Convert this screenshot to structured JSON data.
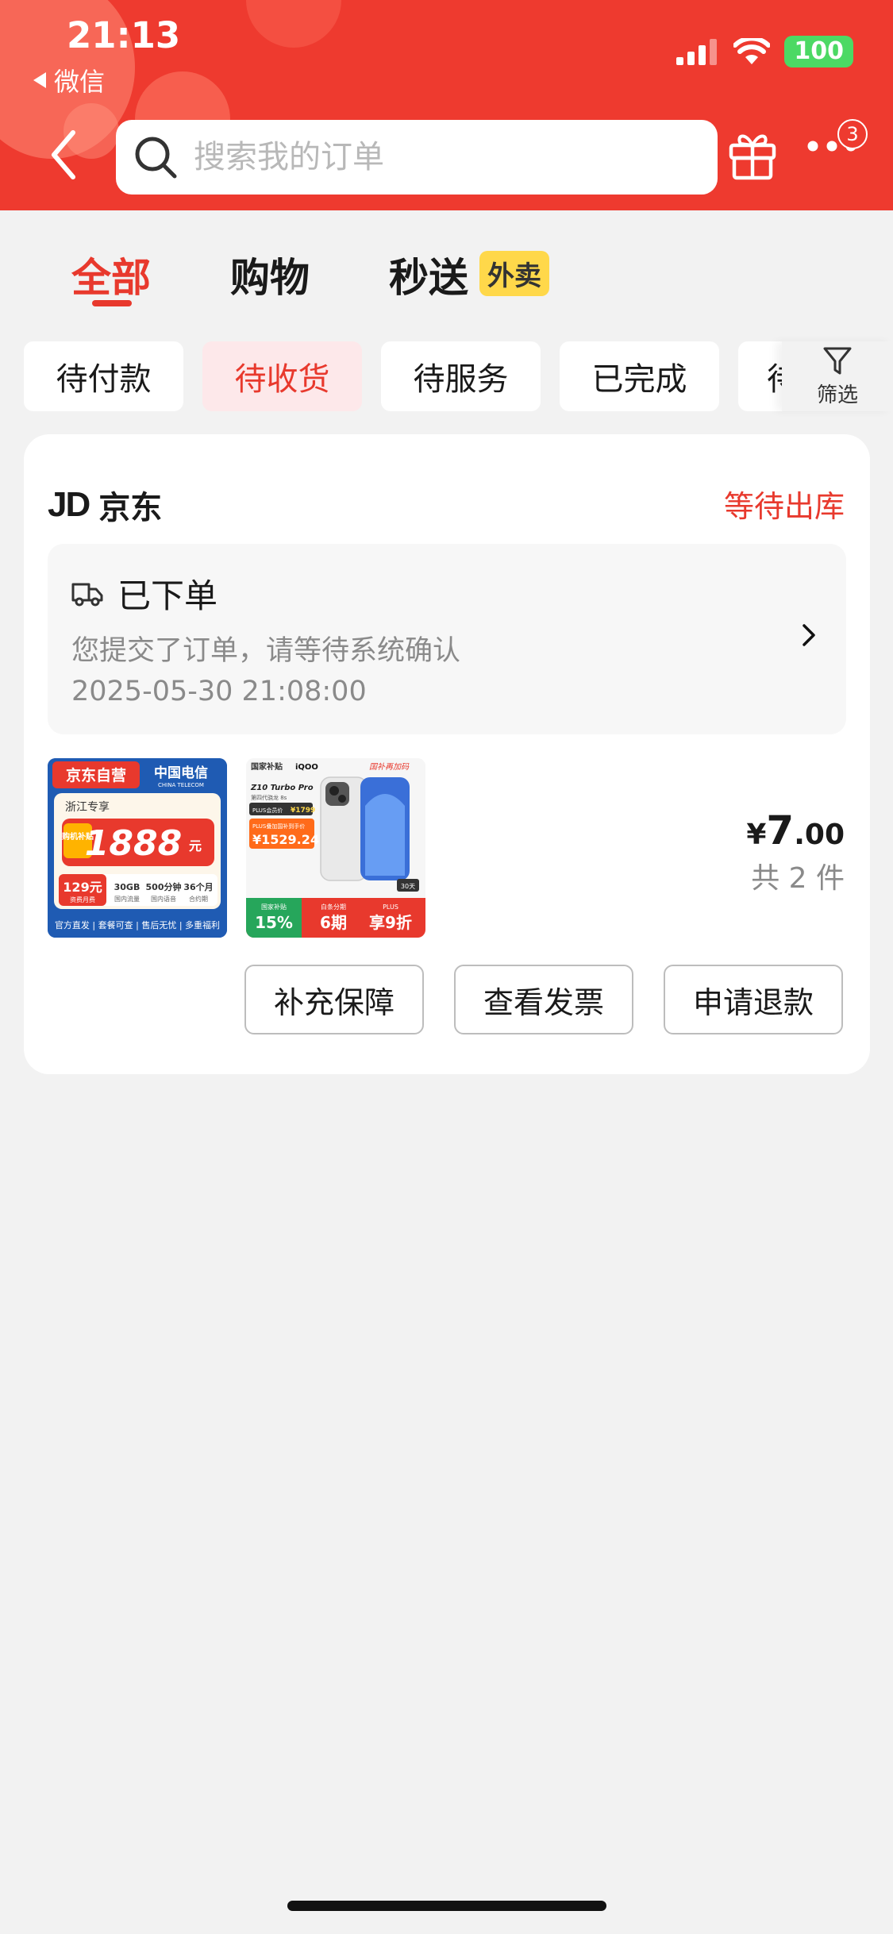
{
  "status_bar": {
    "time": "21:13",
    "back_app": "微信",
    "battery": "100"
  },
  "header": {
    "search_placeholder": "搜索我的订单",
    "more_badge": "3"
  },
  "tabs": [
    {
      "label": "全部",
      "active": true
    },
    {
      "label": "购物",
      "active": false
    },
    {
      "label": "秒送",
      "active": false,
      "tag": "外卖"
    }
  ],
  "chips": [
    {
      "label": "待付款",
      "active": false
    },
    {
      "label": "待收货",
      "active": true
    },
    {
      "label": "待服务",
      "active": false
    },
    {
      "label": "已完成",
      "active": false
    },
    {
      "label": "待",
      "active": false
    }
  ],
  "filter_label": "筛选",
  "order": {
    "shop_logo": "JD",
    "shop_name": "京东",
    "status": "等待出库",
    "track_title": "已下单",
    "track_desc": "您提交了订单，请等待系统确认",
    "track_time": "2025-05-30 21:08:00",
    "price_symbol": "¥",
    "price_int": "7",
    "price_dec": ".00",
    "count": "共 2 件",
    "products": [
      {
        "badge": "京东自营",
        "brand": "中国电信",
        "brand_en": "CHINA TELECOM",
        "region": "浙江专享",
        "subsidy": "购机补贴",
        "amount": "1888",
        "unit": "元",
        "fee": "129元",
        "fee_note": "资费月费",
        "specs": [
          "30GB",
          "500分钟",
          "36个月"
        ],
        "spec_notes": [
          "国内流量",
          "国内语音",
          "合约期"
        ],
        "footer": "官方直发 | 套餐可查 | 售后无忧 | 多重福利"
      },
      {
        "top_left": "国家补贴",
        "brand": "iQOO",
        "slogan": "国补再加码",
        "model": "Z10 Turbo Pro",
        "chip": "第四代骁龙 8s",
        "plus_price_label": "PLUS会员价",
        "plus_price": "¥1799",
        "sub_price_label": "PLUS叠加国补到手价",
        "sub_price": "¥1529.24",
        "badge_30": "30天",
        "pct": "15%",
        "pct_label": "国家补贴",
        "period": "6期",
        "period_label": "白条分期",
        "discount": "享9折",
        "discount_label": "PLUS"
      }
    ],
    "buttons": [
      "补充保障",
      "查看发票",
      "申请退款"
    ]
  },
  "colors": {
    "header_red": "#ee3a2f",
    "accent_red": "#e8392d",
    "chip_active_bg": "#fde8ea",
    "waimai_yellow": "#ffd84a"
  }
}
